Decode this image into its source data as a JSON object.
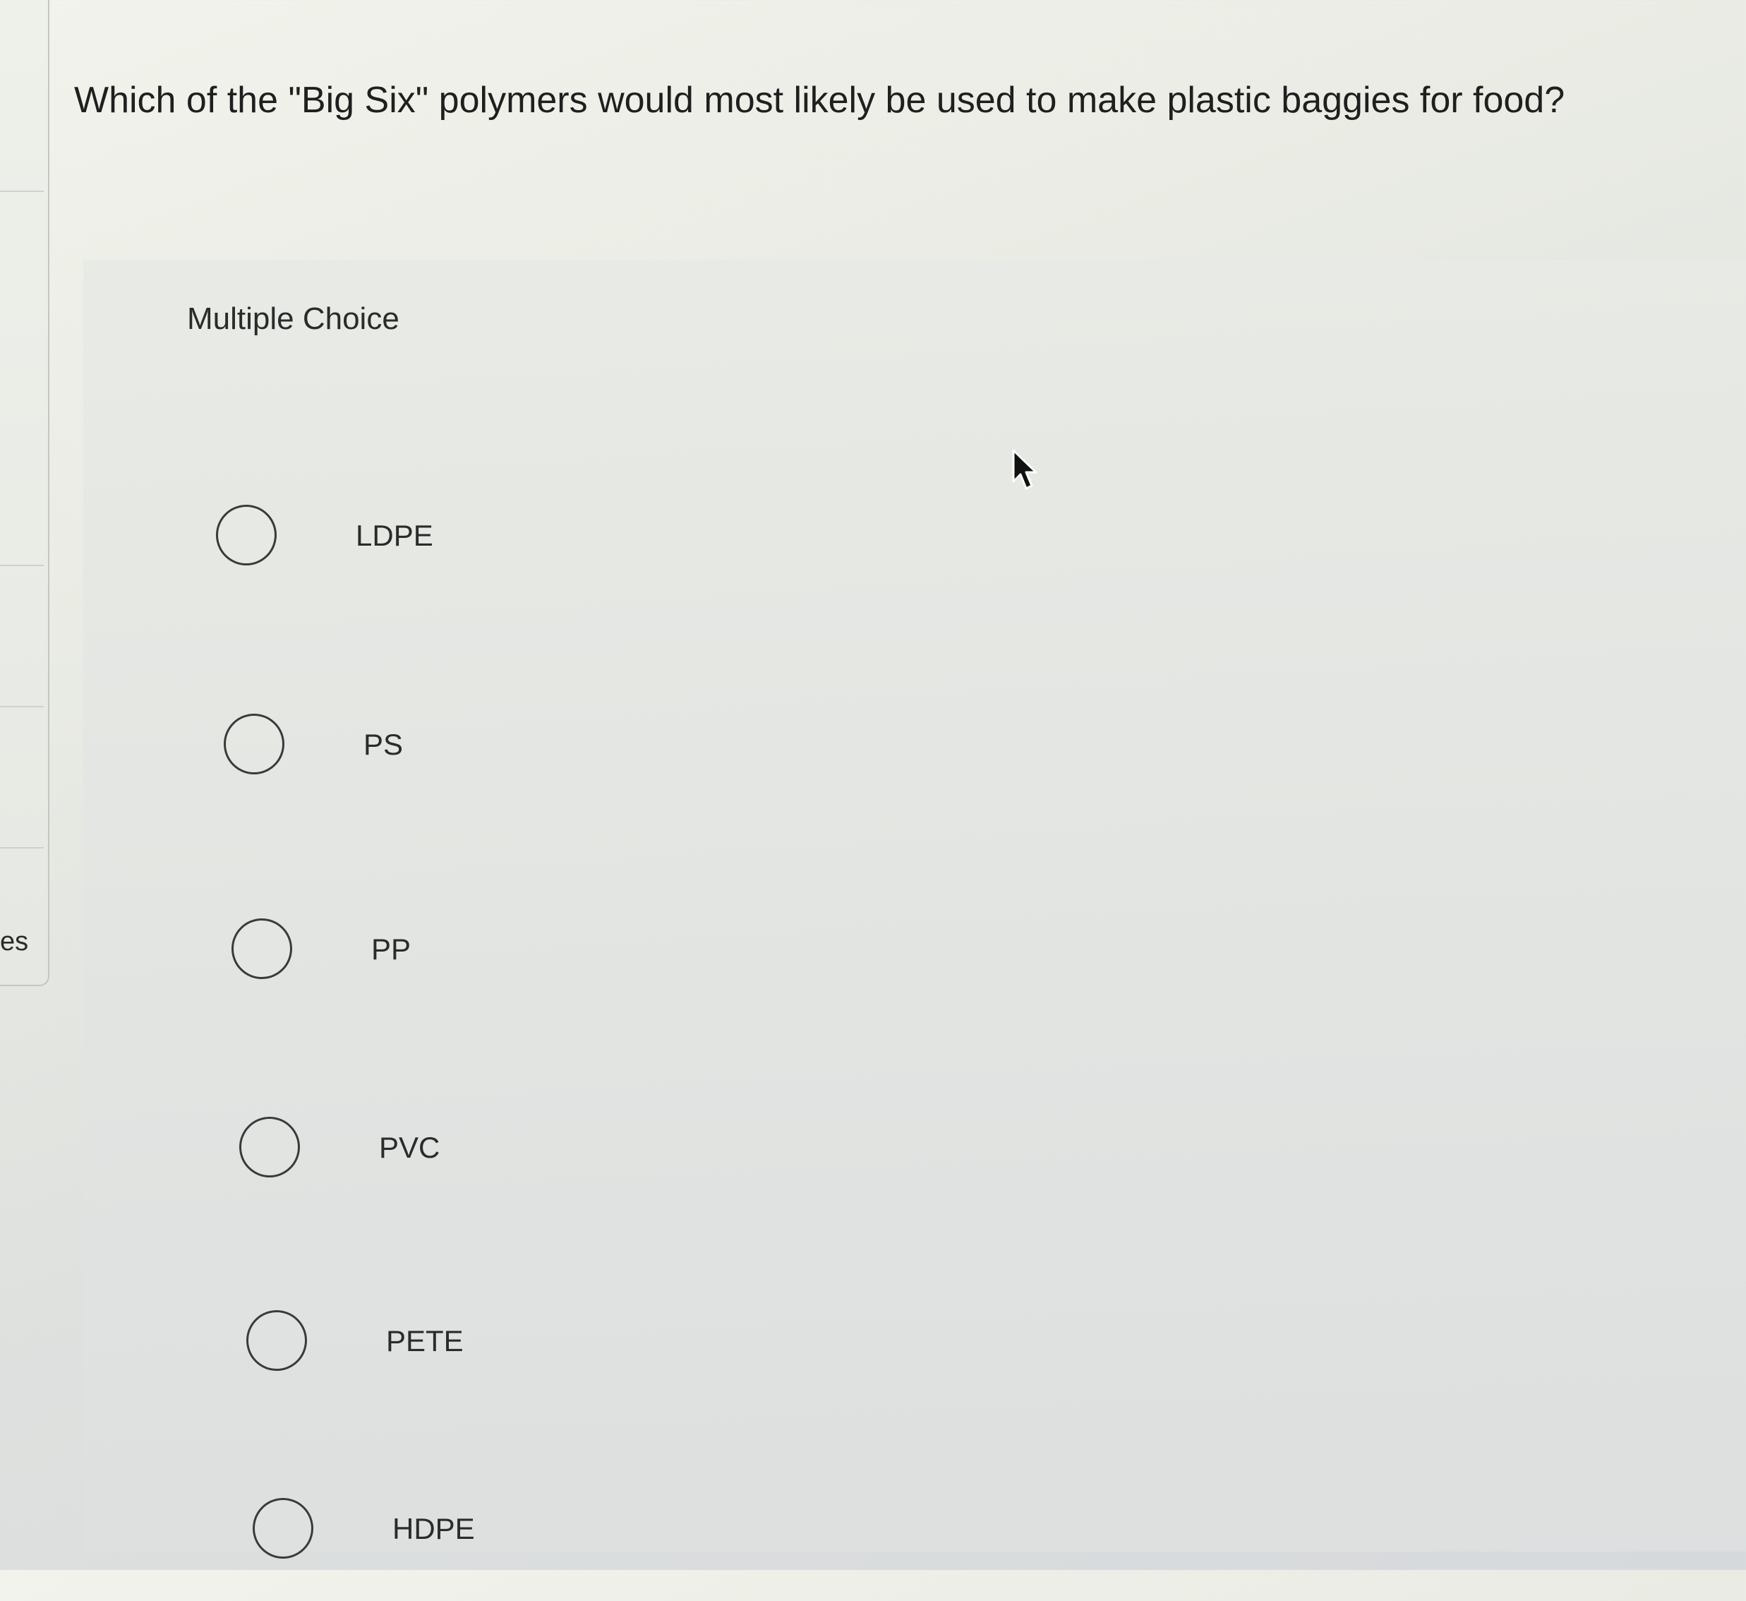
{
  "sidebar": {
    "partial_label": "es"
  },
  "question": {
    "text": "Which of the \"Big Six\" polymers would most likely be used to make plastic baggies for food?",
    "type_label": "Multiple Choice"
  },
  "options": [
    {
      "label": "LDPE",
      "selected": false
    },
    {
      "label": "PS",
      "selected": false
    },
    {
      "label": "PP",
      "selected": false
    },
    {
      "label": "PVC",
      "selected": false
    },
    {
      "label": "PETE",
      "selected": false
    },
    {
      "label": "HDPE",
      "selected": false
    }
  ]
}
